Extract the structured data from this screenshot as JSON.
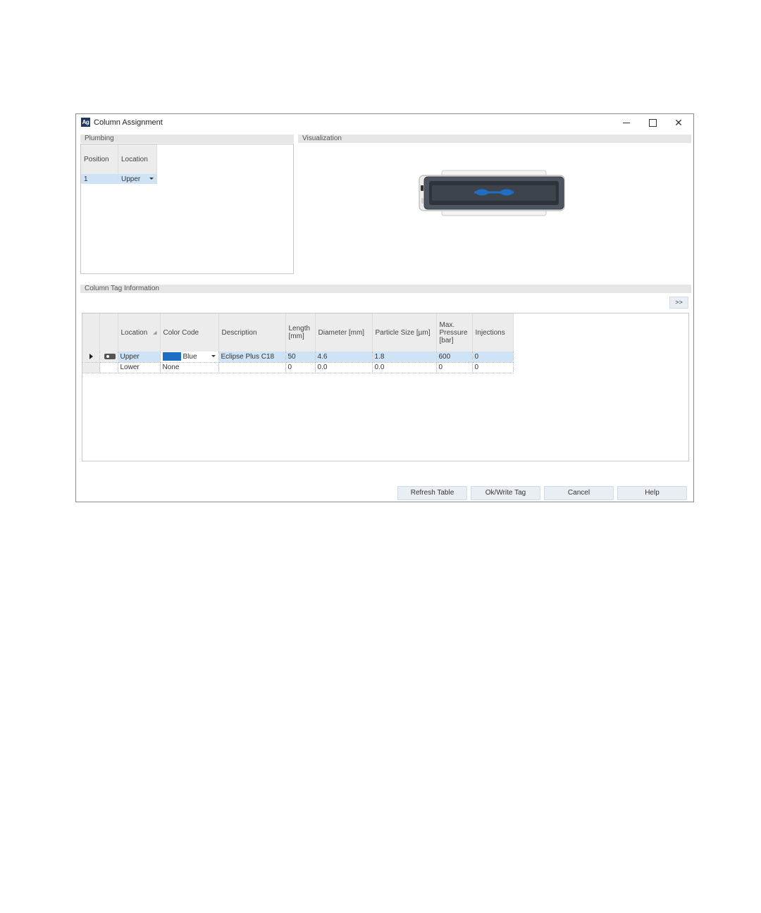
{
  "window": {
    "app_icon": "Ag",
    "title": "Column Assignment"
  },
  "plumbing": {
    "header": "Plumbing",
    "columns": [
      "Position",
      "Location"
    ],
    "rows": [
      {
        "position": "1",
        "location": "Upper"
      }
    ]
  },
  "visualization": {
    "header": "Visualization",
    "column_color": "#1e6fc4"
  },
  "column_tag": {
    "header": "Column Tag Information",
    "expand_label": ">>",
    "columns": {
      "location": "Location",
      "color_code": "Color Code",
      "description": "Description",
      "length": "Length [mm]",
      "diameter": "Diameter [mm]",
      "particle_size": "Particle Size [µm]",
      "max_pressure": "Max. Pressure [bar]",
      "injections": "Injections"
    },
    "rows": [
      {
        "location": "Upper",
        "color_name": "Blue",
        "color_hex": "#1e6fc4",
        "description": "Eclipse Plus C18",
        "length": "50",
        "diameter": "4.6",
        "particle_size": "1.8",
        "max_pressure": "600",
        "injections": "0"
      },
      {
        "location": "Lower",
        "color_name": "None",
        "color_hex": "",
        "description": "",
        "length": "0",
        "diameter": "0.0",
        "particle_size": "0.0",
        "max_pressure": "0",
        "injections": "0"
      }
    ]
  },
  "buttons": {
    "refresh": "Refresh Table",
    "ok_write": "Ok/Write Tag",
    "cancel": "Cancel",
    "help": "Help"
  }
}
